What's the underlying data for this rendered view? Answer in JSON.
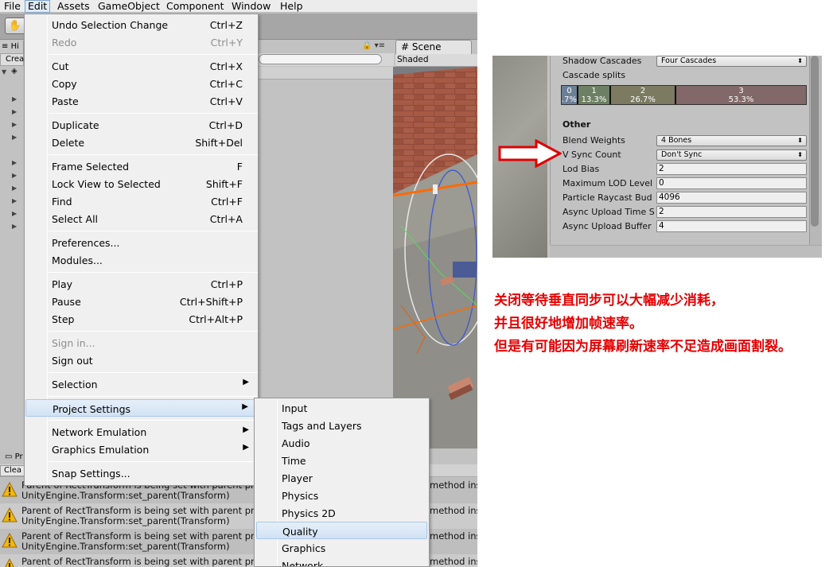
{
  "menubar": {
    "items": [
      "File",
      "Edit",
      "Assets",
      "GameObject",
      "Component",
      "Window",
      "Help"
    ],
    "open_item": "Edit"
  },
  "hierarchy": {
    "tab": "Hi",
    "create": "Crea"
  },
  "project": {
    "tab": "Pr"
  },
  "console": {
    "clear": "Clea",
    "rows": [
      {
        "line1": "Parent of RectTransform is being set with parent pr",
        "line2": "UnityEngine.Transform:set_parent(Transform)",
        "right": "method ins"
      },
      {
        "line1": "Parent of RectTransform is being set with parent pr",
        "line2": "UnityEngine.Transform:set_parent(Transform)",
        "right": "method ins"
      },
      {
        "line1": "Parent of RectTransform is being set with parent pr",
        "line2": "UnityEngine.Transform:set_parent(Transform)",
        "right": "method ins"
      },
      {
        "line1": "Parent of RectTransform is being set with parent pr",
        "line2": "",
        "right": "method ins"
      }
    ]
  },
  "scene": {
    "tab": "Scene",
    "mode": "Shaded"
  },
  "edit_menu": {
    "undo": {
      "label": "Undo Selection Change",
      "shortcut": "Ctrl+Z"
    },
    "redo": {
      "label": "Redo",
      "shortcut": "Ctrl+Y"
    },
    "cut": {
      "label": "Cut",
      "shortcut": "Ctrl+X"
    },
    "copy": {
      "label": "Copy",
      "shortcut": "Ctrl+C"
    },
    "paste": {
      "label": "Paste",
      "shortcut": "Ctrl+V"
    },
    "duplicate": {
      "label": "Duplicate",
      "shortcut": "Ctrl+D"
    },
    "delete": {
      "label": "Delete",
      "shortcut": "Shift+Del"
    },
    "frame_selected": {
      "label": "Frame Selected",
      "shortcut": "F"
    },
    "lock_view": {
      "label": "Lock View to Selected",
      "shortcut": "Shift+F"
    },
    "find": {
      "label": "Find",
      "shortcut": "Ctrl+F"
    },
    "select_all": {
      "label": "Select All",
      "shortcut": "Ctrl+A"
    },
    "preferences": {
      "label": "Preferences..."
    },
    "modules": {
      "label": "Modules..."
    },
    "play": {
      "label": "Play",
      "shortcut": "Ctrl+P"
    },
    "pause": {
      "label": "Pause",
      "shortcut": "Ctrl+Shift+P"
    },
    "step": {
      "label": "Step",
      "shortcut": "Ctrl+Alt+P"
    },
    "sign_in": {
      "label": "Sign in..."
    },
    "sign_out": {
      "label": "Sign out"
    },
    "selection": {
      "label": "Selection"
    },
    "project_settings": {
      "label": "Project Settings"
    },
    "network_emulation": {
      "label": "Network Emulation"
    },
    "graphics_emulation": {
      "label": "Graphics Emulation"
    },
    "snap_settings": {
      "label": "Snap Settings..."
    }
  },
  "project_settings_submenu": {
    "items": [
      "Input",
      "Tags and Layers",
      "Audio",
      "Time",
      "Player",
      "Physics",
      "Physics 2D",
      "Quality",
      "Graphics",
      "Network"
    ],
    "highlighted": "Quality"
  },
  "quality_settings": {
    "shadow_cascades": {
      "label": "Shadow Cascades",
      "value": "Four Cascades"
    },
    "cascade_splits": {
      "label": "Cascade splits",
      "segments": [
        {
          "index": "0",
          "percent": ".7%",
          "fraction": 0.067,
          "color": "#6b8096"
        },
        {
          "index": "1",
          "percent": "13.3%",
          "fraction": 0.133,
          "color": "#6d8063"
        },
        {
          "index": "2",
          "percent": "26.7%",
          "fraction": 0.267,
          "color": "#7c7b62"
        },
        {
          "index": "3",
          "percent": "53.3%",
          "fraction": 0.533,
          "color": "#826868"
        }
      ]
    },
    "other_heading": "Other",
    "blend_weights": {
      "label": "Blend Weights",
      "value": "4 Bones"
    },
    "vsync": {
      "label": "V Sync Count",
      "value": "Don't Sync"
    },
    "lod_bias": {
      "label": "Lod Bias",
      "value": "2"
    },
    "max_lod": {
      "label": "Maximum LOD Level",
      "value": "0"
    },
    "particle_raycast": {
      "label": "Particle Raycast Bud",
      "value": "4096"
    },
    "async_upload_time": {
      "label": "Async Upload Time S",
      "value": "2"
    },
    "async_upload_buffer": {
      "label": "Async Upload Buffer",
      "value": "4"
    }
  },
  "annotation": {
    "lines": [
      "关闭等待垂直同步可以大幅减少消耗，",
      "并且很好地增加帧速率。",
      "但是有可能因为屏幕刷新速率不足造成画面割裂。"
    ],
    "color": "#e50000"
  }
}
